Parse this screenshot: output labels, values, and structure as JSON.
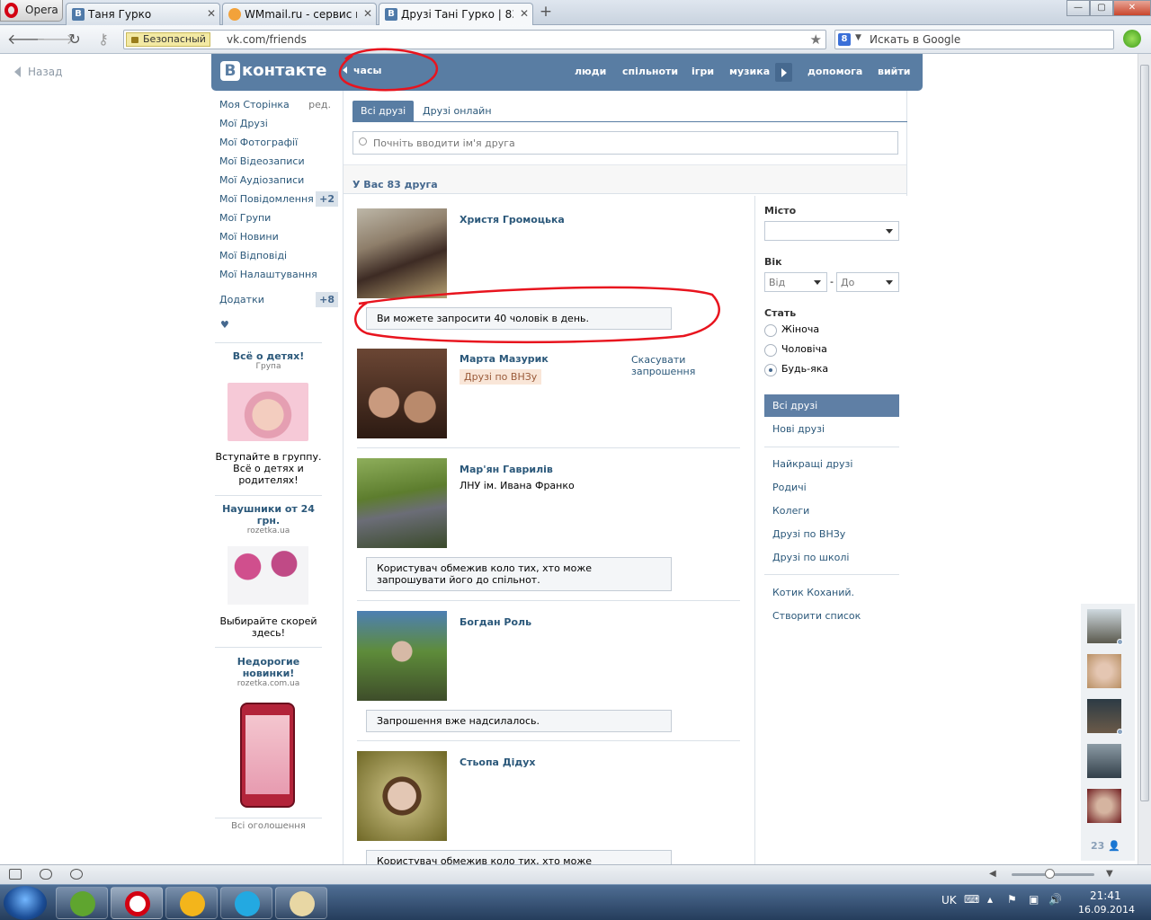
{
  "browser": {
    "menu_label": "Opera",
    "tabs": [
      {
        "title": "Таня Гурко",
        "favicon": "В"
      },
      {
        "title": "WMmail.ru - сервис п...",
        "favicon": ""
      },
      {
        "title": "Друзі Тані Гурко | 83 д...",
        "favicon": "В"
      }
    ],
    "security_label": "Безопасный",
    "url": "vk.com/friends",
    "search_placeholder": "Искать в Google",
    "search_engine": "8"
  },
  "page": {
    "back_label": "Назад",
    "header": {
      "logo_letter": "В",
      "logo_text": "контакте",
      "player_label": "часы",
      "nav": [
        "люди",
        "спільноти",
        "ігри",
        "музика",
        "допомога",
        "вийти"
      ]
    },
    "left_menu": {
      "items": [
        {
          "label": "Моя Сторінка",
          "extra": "ред."
        },
        {
          "label": "Мої Друзі"
        },
        {
          "label": "Мої Фотографії"
        },
        {
          "label": "Мої Відеозаписи"
        },
        {
          "label": "Мої Аудіозаписи"
        },
        {
          "label": "Мої Повідомлення",
          "count": "+2"
        },
        {
          "label": "Мої Групи"
        },
        {
          "label": "Мої Новини"
        },
        {
          "label": "Мої Відповіді"
        },
        {
          "label": "Мої Налаштування"
        }
      ],
      "apps": {
        "label": "Додатки",
        "count": "+8"
      },
      "heart": "♥"
    },
    "ads": [
      {
        "title": "Всё о детях!",
        "sub": "Група",
        "text": "Вступайте в группу. Всё о детях и родителях!"
      },
      {
        "title": "Наушники от 24 грн.",
        "sub": "rozetka.ua",
        "text": "Выбирайте скорей здесь!"
      },
      {
        "title": "Недорогие новинки!",
        "sub": "rozetka.com.ua",
        "text": ""
      }
    ],
    "all_ads_label": "Всі оголошення",
    "tabs": [
      "Всі друзі",
      "Друзі онлайн"
    ],
    "friend_search_placeholder": "Почніть вводити ім'я друга",
    "friends_count": "У Вас 83 друга",
    "friends": [
      {
        "name": "Христя Громоцька",
        "sub": "",
        "tag": "",
        "cancel": "",
        "notice": "Ви можете запросити 40 чоловік в день."
      },
      {
        "name": "Марта Мазурик",
        "sub": "",
        "tag": "Друзі по ВНЗу",
        "cancel": "Скасувати запрошення",
        "notice": ""
      },
      {
        "name": "Мар'ян Гаврилів",
        "sub": "ЛНУ ім. Ивана Франко",
        "tag": "",
        "cancel": "",
        "notice": "Користувач обмежив коло тих, хто може запрошувати його до спільнот."
      },
      {
        "name": "Богдан Роль",
        "sub": "",
        "tag": "",
        "cancel": "",
        "notice": "Запрошення вже надсилалось."
      },
      {
        "name": "Стьопа Дідух",
        "sub": "",
        "tag": "",
        "cancel": "",
        "notice": "Користувач обмежив коло тих, хто може запрошувати його"
      }
    ],
    "filter": {
      "city_label": "Місто",
      "age_label": "Вік",
      "age_from": "Від",
      "age_dash": "-",
      "age_to": "До",
      "sex_label": "Стать",
      "sex_options": [
        "Жіноча",
        "Чоловіча",
        "Будь-яка"
      ],
      "menu1": [
        "Всі друзі",
        "Нові друзі"
      ],
      "menu2": [
        "Найкращі друзі",
        "Родичі",
        "Колеги",
        "Друзі по ВНЗу",
        "Друзі по школі"
      ],
      "menu3": [
        "Котик Коханий.",
        "Створити список"
      ]
    },
    "online_count": "23"
  },
  "taskbar": {
    "lang": "UK",
    "time": "21:41",
    "date": "16.09.2014"
  },
  "colors": {
    "vk_blue": "#597da3",
    "link": "#2b587a",
    "annotation_red": "#e8141e"
  }
}
